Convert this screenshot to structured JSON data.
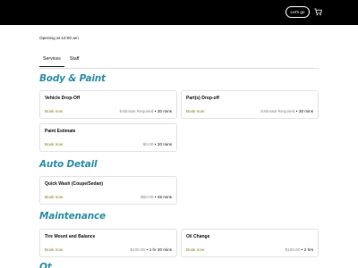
{
  "header": {
    "cta_label": "Let's go",
    "cart_icon": "cart-icon"
  },
  "opening_text": "Opening at 10:00 am",
  "tabs": [
    {
      "label": "Services"
    },
    {
      "label": "Staff"
    }
  ],
  "sections": [
    {
      "title": "Body & Paint",
      "services": [
        {
          "name": "Vehicle Drop-Off",
          "book": "Book now",
          "price": "Estimate Required",
          "duration": "30 mins"
        },
        {
          "name": "Part(s) Drop-off",
          "book": "Book now",
          "price": "Estimate Required",
          "duration": "30 mins"
        },
        {
          "name": "Paint Estimate",
          "book": "Book now",
          "price": "$0.00",
          "duration": "30 mins"
        }
      ]
    },
    {
      "title": "Auto Detail",
      "services": [
        {
          "name": "Quick Wash (Coupe/Sedan)",
          "book": "Book now",
          "price": "$50.00",
          "duration": "45 mins"
        }
      ]
    },
    {
      "title": "Maintenance",
      "services": [
        {
          "name": "Tire Mount and Balance",
          "book": "Book now",
          "price": "$100.00",
          "duration": "1 hr 30 mins"
        },
        {
          "name": "Oil Change",
          "book": "Book now",
          "price": "$100.00",
          "duration": "2 hrs"
        }
      ]
    },
    {
      "title": "Ot"
    }
  ],
  "colors": {
    "accent": "#2e8ea8",
    "book_link": "#8a7a2a",
    "topbar": "#000000"
  }
}
